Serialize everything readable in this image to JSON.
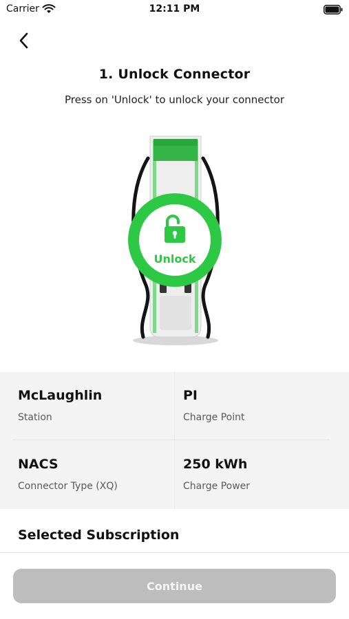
{
  "status_bar": {
    "carrier": "Carrier",
    "time": "12:11 PM"
  },
  "header": {
    "back_icon": "chevron-left-icon"
  },
  "step": {
    "title": "1. Unlock Connector",
    "subtitle": "Press on 'Unlock' to unlock your connector"
  },
  "unlock": {
    "label": "Unlock",
    "icon": "unlocked-padlock-icon",
    "accent_color": "#2ec944"
  },
  "details": [
    {
      "value": "McLaughlin",
      "label": "Station"
    },
    {
      "value": "PI",
      "label": "Charge Point"
    },
    {
      "value": "NACS",
      "label": "Connector Type (XQ)"
    },
    {
      "value": "250 kWh",
      "label": "Charge Power"
    }
  ],
  "subscription": {
    "title": "Selected Subscription"
  },
  "continue": {
    "label": "Continue",
    "disabled_color": "#bdbdbd"
  }
}
